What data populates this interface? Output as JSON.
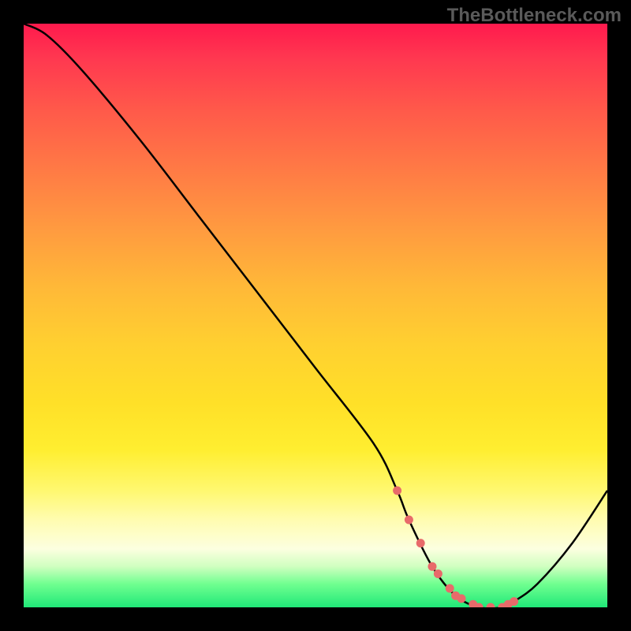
{
  "watermark": "TheBottleneck.com",
  "chart_data": {
    "type": "line",
    "title": "",
    "xlabel": "",
    "ylabel": "",
    "xlim": [
      0,
      100
    ],
    "ylim": [
      0,
      100
    ],
    "series": [
      {
        "name": "bottleneck-curve",
        "x": [
          0,
          4,
          10,
          20,
          30,
          40,
          50,
          60,
          64,
          66,
          70,
          74,
          78,
          82,
          84,
          88,
          94,
          100
        ],
        "values": [
          100,
          98,
          92,
          80,
          67,
          54,
          41,
          28,
          20,
          15,
          7,
          2,
          0,
          0,
          1,
          4,
          11,
          20
        ]
      }
    ],
    "flat_region": {
      "x_start": 64,
      "x_end": 84
    },
    "dot_positions_x": [
      64,
      66,
      68,
      70,
      71,
      73,
      74,
      75,
      77,
      78,
      80,
      82,
      83,
      84
    ],
    "colors": {
      "curve": "#000000",
      "dots": "#e86a6a",
      "gradient_top": "#ff1a4d",
      "gradient_bottom": "#20e878"
    }
  }
}
